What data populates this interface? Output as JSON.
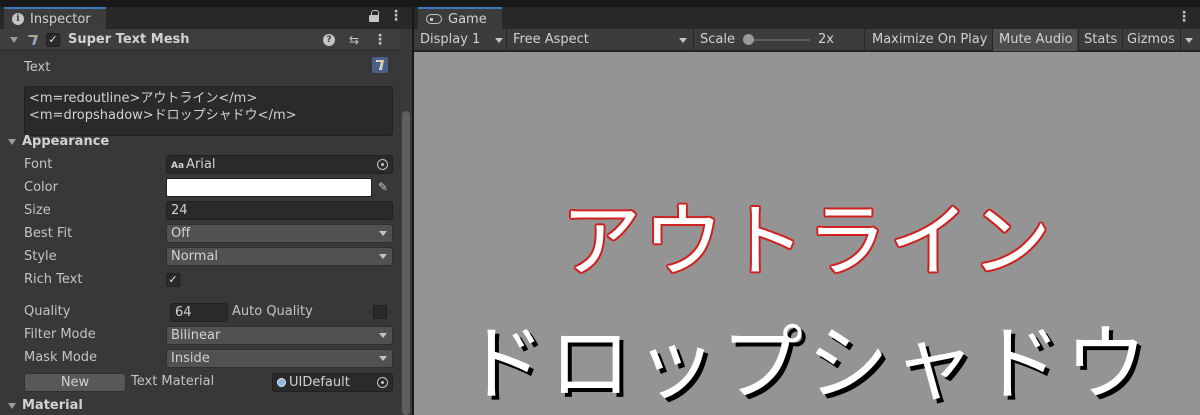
{
  "inspector": {
    "tab_title": "Inspector",
    "component": {
      "title": "Super Text Mesh",
      "enabled_check": "✓"
    },
    "text": {
      "label": "Text",
      "value": "<m=redoutline>アウトライン</m>\n<m=dropshadow>ドロップシャドウ</m>"
    },
    "appearance": {
      "label": "Appearance",
      "font_label": "Font",
      "font_value": "Arial",
      "font_icon_text": "Aa",
      "color_label": "Color",
      "color_value": "#ffffff",
      "size_label": "Size",
      "size_value": "24",
      "best_fit_label": "Best Fit",
      "best_fit_value": "Off",
      "style_label": "Style",
      "style_value": "Normal",
      "rich_text_label": "Rich Text",
      "rich_text_check": "✓",
      "quality_label": "Quality",
      "quality_value": "64",
      "auto_quality_label": "Auto Quality",
      "filter_mode_label": "Filter Mode",
      "filter_mode_value": "Bilinear",
      "mask_mode_label": "Mask Mode",
      "mask_mode_value": "Inside",
      "new_button": "New",
      "text_material_label": "Text Material",
      "text_material_value": "UIDefault"
    },
    "material": {
      "label": "Material"
    }
  },
  "game": {
    "tab_title": "Game",
    "toolbar": {
      "display": "Display 1",
      "aspect": "Free Aspect",
      "scale_label": "Scale",
      "scale_value": "2x",
      "maximize_on_play": "Maximize On Play",
      "mute_audio": "Mute Audio",
      "stats": "Stats",
      "gizmos": "Gizmos"
    },
    "viewport": {
      "outline_text": "アウトライン",
      "dropshadow_text": "ドロップシャドウ",
      "background_color": "#949494",
      "outline_color": "#d02020"
    }
  }
}
